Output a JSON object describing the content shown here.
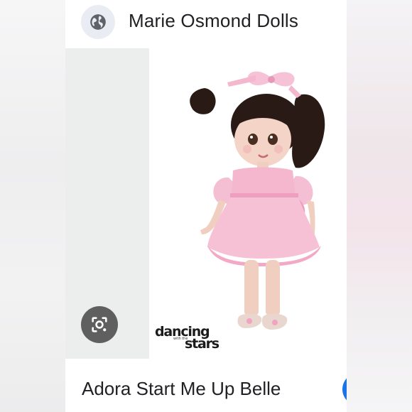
{
  "result_card": {
    "site_name": "Marie Osmond Dolls",
    "title": "Adora Start Me Up Belle",
    "image": {
      "subject": "doll-photo",
      "watermark_line1": "dancing",
      "watermark_small": "with the",
      "watermark_line2": "stars"
    }
  },
  "icons": {
    "site": "globe-icon",
    "lens": "google-lens-icon"
  },
  "colors": {
    "accent_blue": "#1a73e8",
    "lens_button_bg": "#5f5f5f",
    "dress_pink": "#f4b7cd",
    "hair": "#2a1a16"
  }
}
